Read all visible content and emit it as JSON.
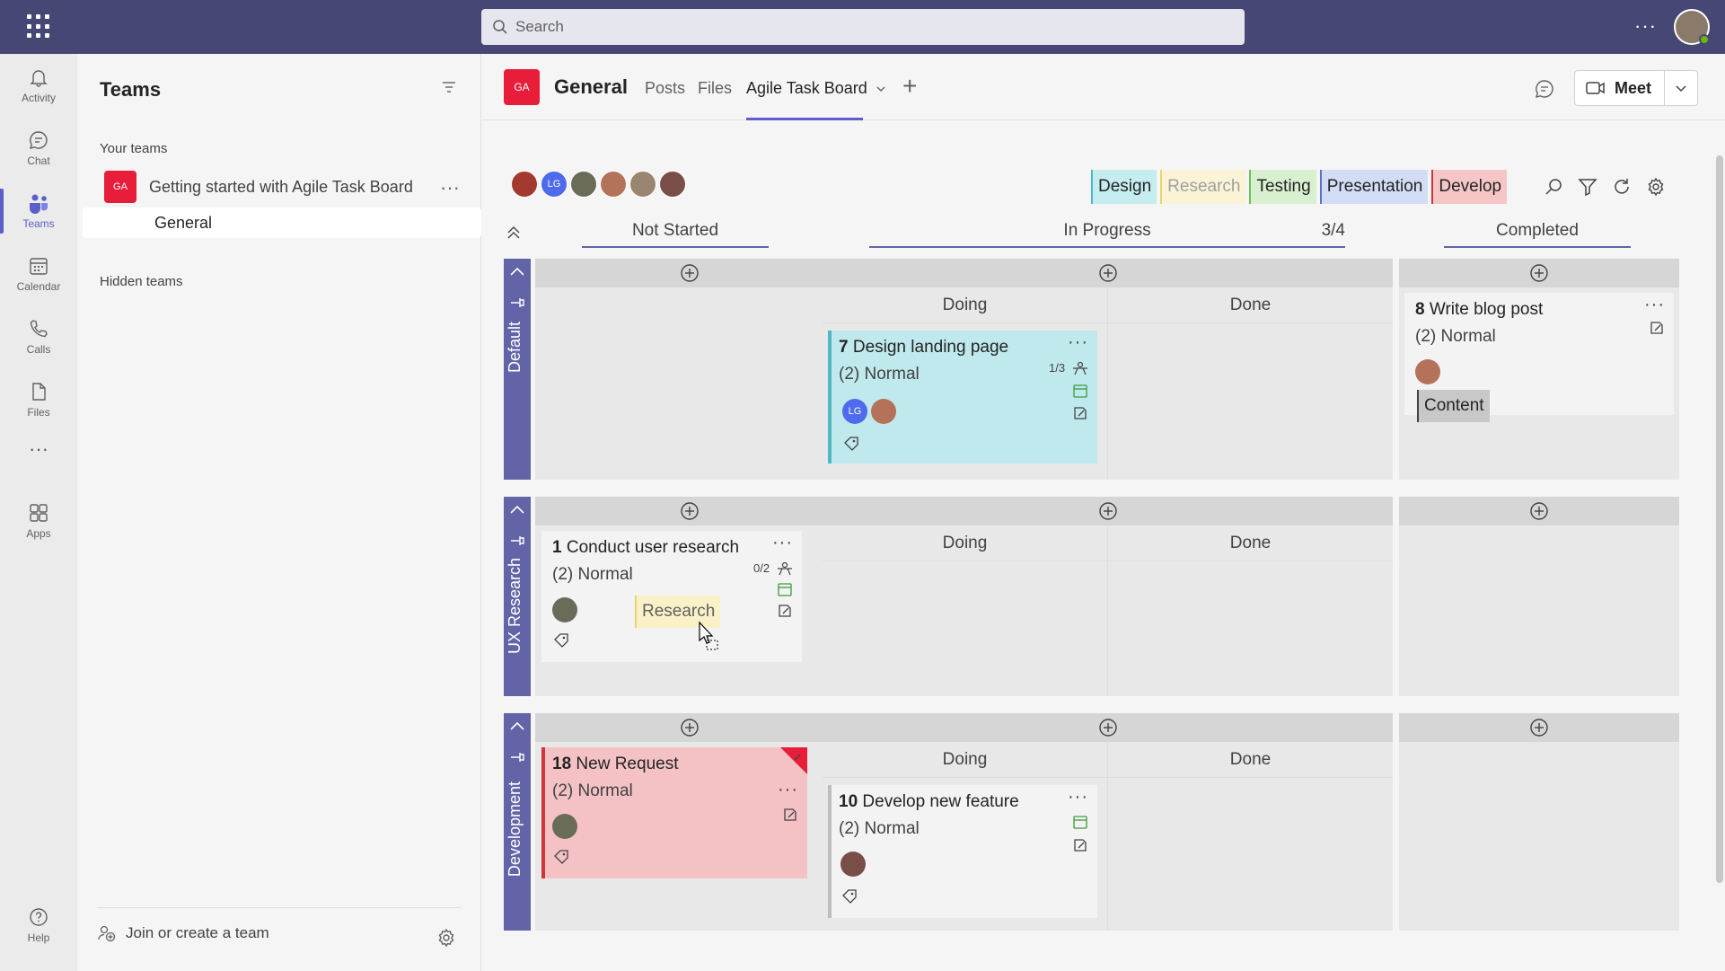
{
  "search": {
    "placeholder": "Search"
  },
  "rail": [
    {
      "label": "Activity",
      "icon": "bell-icon"
    },
    {
      "label": "Chat",
      "icon": "chat-icon"
    },
    {
      "label": "Teams",
      "icon": "teams-icon",
      "active": true
    },
    {
      "label": "Calendar",
      "icon": "calendar-icon"
    },
    {
      "label": "Calls",
      "icon": "phone-icon"
    },
    {
      "label": "Files",
      "icon": "file-icon"
    },
    {
      "label": "Apps",
      "icon": "apps-icon"
    },
    {
      "label": "Help",
      "icon": "help-icon"
    }
  ],
  "teams_pane": {
    "title": "Teams",
    "your_teams": "Your teams",
    "team": {
      "initials": "GA",
      "name": "Getting started with Agile Task Board"
    },
    "channel": "General",
    "hidden_teams": "Hidden teams",
    "join": "Join or create a team"
  },
  "channel": {
    "initials": "GA",
    "name": "General",
    "tabs": [
      "Posts",
      "Files",
      "Agile Task Board"
    ],
    "meet": "Meet"
  },
  "board": {
    "member_avatar_initials": "LG",
    "filter_tags": [
      {
        "label": "Design",
        "bg": "#c5ecef",
        "border": "#4fb8c3"
      },
      {
        "label": "Research",
        "bg": "#faf3d6",
        "border": "#e8d66a",
        "color": "#a0a0a0"
      },
      {
        "label": "Testing",
        "bg": "#d8f0cf",
        "border": "#6bbf55"
      },
      {
        "label": "Presentation",
        "bg": "#d2dcf5",
        "border": "#5a73c9"
      },
      {
        "label": "Develop",
        "bg": "#f6c6c6",
        "border": "#d13438"
      }
    ],
    "columns": {
      "not_started": "Not Started",
      "in_progress": "In Progress",
      "in_progress_wip": "3/4",
      "completed": "Completed"
    },
    "sub_columns": {
      "doing": "Doing",
      "done": "Done"
    },
    "lanes": [
      "Default",
      "UX Research",
      "Development"
    ],
    "cards": {
      "c7": {
        "num": "7",
        "title": "Design landing page",
        "priority": "(2) Normal",
        "checklist": "1/3",
        "avatar": "LG"
      },
      "c8": {
        "num": "8",
        "title": "Write blog post",
        "priority": "(2) Normal",
        "label": "Content"
      },
      "c1": {
        "num": "1",
        "title": "Conduct user research",
        "priority": "(2) Normal",
        "checklist": "0/2",
        "label": "Research"
      },
      "c18": {
        "num": "18",
        "title": "New Request",
        "priority": "(2) Normal"
      },
      "c10": {
        "num": "10",
        "title": "Develop new feature",
        "priority": "(2) Normal"
      }
    }
  }
}
